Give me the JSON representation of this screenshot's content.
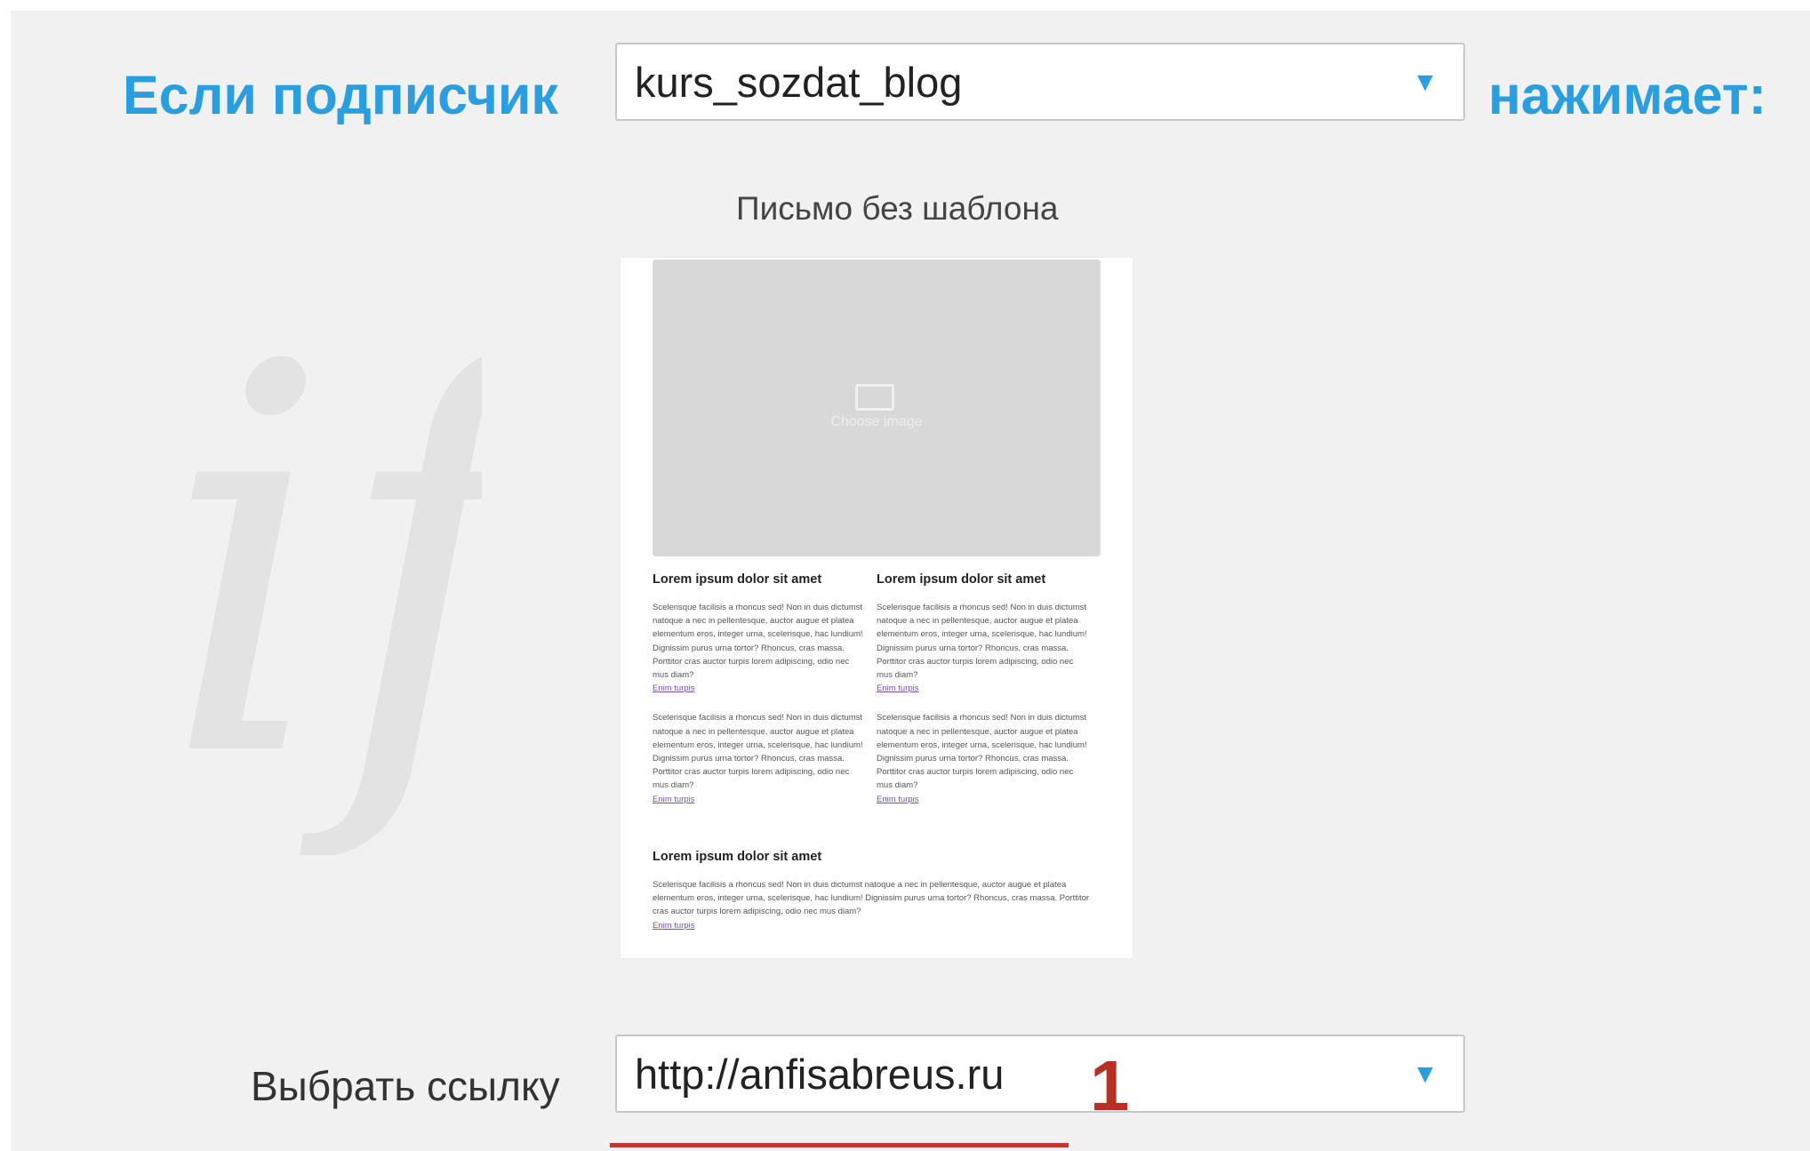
{
  "condition": {
    "prefix": "Если подписчик",
    "letter_select": {
      "value": "kurs_sozdat_blog",
      "arrow": "▼"
    },
    "suffix": "нажимает:"
  },
  "preview": {
    "caption": "Письмо без шаблона",
    "watermark": "if",
    "image_placeholder": "Choose image",
    "col_left": {
      "heading": "Lorem ipsum dolor sit amet",
      "para1": "Scelerisque facilisis a rhoncus sed! Non in duis dictumst natoque a nec in pellentesque, auctor augue et platea elementum eros, integer urna, scelerisque, hac lundium! Dignissim purus urna tortor? Rhoncus, cras massa. Porttitor cras auctor turpis lorem adipiscing, odio nec mus diam?",
      "link1": "Enim turpis",
      "para2": "Scelerisque facilisis a rhoncus sed! Non in duis dictumst natoque a nec in pellentesque, auctor augue et platea elementum eros, integer urna, scelerisque, hac lundium! Dignissim purus urna tortor? Rhoncus, cras massa. Porttitor cras auctor turpis lorem adipiscing, odio nec mus diam?",
      "link2": "Enim turpis"
    },
    "col_right": {
      "heading": "Lorem ipsum dolor sit amet",
      "para1": "Scelerisque facilisis a rhoncus sed! Non in duis dictumst natoque a nec in pellentesque, auctor augue et platea elementum eros, integer urna, scelerisque, hac lundium! Dignissim purus urna tortor? Rhoncus, cras massa. Porttitor cras auctor turpis lorem adipiscing, odio nec mus diam?",
      "link1": "Enim turpis",
      "para2": "Scelerisque facilisis a rhoncus sed! Non in duis dictumst natoque a nec in pellentesque, auctor augue et platea elementum eros, integer urna, scelerisque, hac lundium! Dignissim purus urna tortor? Rhoncus, cras massa. Porttitor cras auctor turpis lorem adipiscing, odio nec mus diam?",
      "link2": "Enim turpis"
    },
    "full": {
      "heading": "Lorem ipsum dolor sit amet",
      "para": "Scelerisque facilisis a rhoncus sed! Non in duis dictumst natoque a nec in pellentesque, auctor augue et platea elementum eros, integer urna, scelerisque, hac lundium! Dignissim purus urna tortor? Rhoncus, cras massa. Porttitor cras auctor turpis lorem adipiscing, odio nec mus diam?",
      "link": "Enim turpis"
    }
  },
  "link_choice": {
    "label": "Выбрать ссылку",
    "select": {
      "value": "http://anfisabreus.ru",
      "arrow": "▼"
    }
  },
  "annotation": {
    "number": "1",
    "color": "#b83023"
  },
  "colors": {
    "accent": "#2a9ede",
    "panel": "#f1f1f1"
  }
}
